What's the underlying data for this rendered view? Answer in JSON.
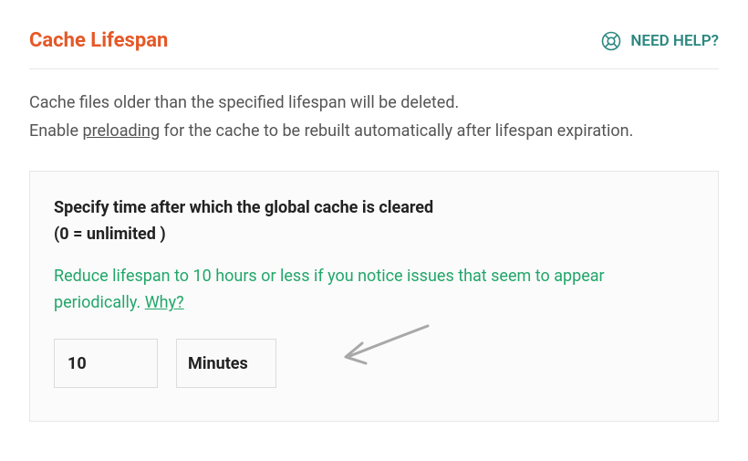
{
  "header": {
    "title": "Cache Lifespan",
    "help_label": "NEED HELP?"
  },
  "description": {
    "line1": "Cache files older than the specified lifespan will be deleted.",
    "line2a": "Enable ",
    "preloading_link": "preloading",
    "line2b": " for the cache to be rebuilt automatically after lifespan expiration."
  },
  "settings": {
    "label_line1": "Specify time after which the global cache is cleared",
    "label_line2": "(0 = unlimited )",
    "hint_text": "Reduce lifespan to 10 hours or less if you notice issues that seem to appear periodically. ",
    "why_link": "Why?",
    "value": "10",
    "unit": "Minutes"
  }
}
